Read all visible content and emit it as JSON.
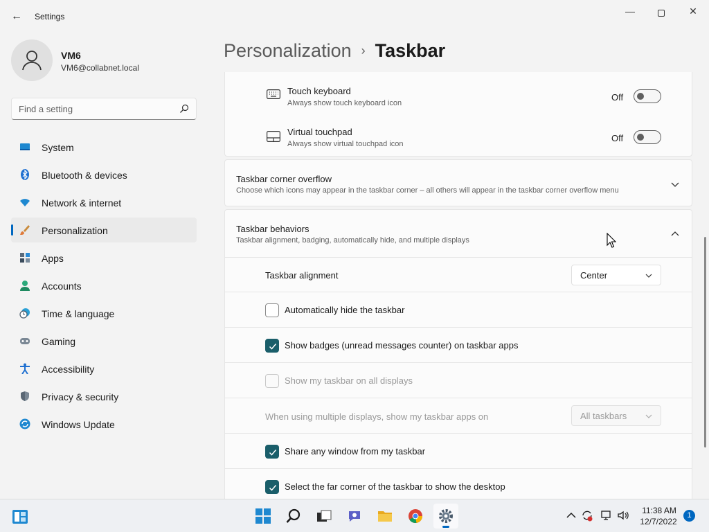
{
  "window": {
    "title": "Settings",
    "back_glyph": "←",
    "minimize_glyph": "—",
    "close_glyph": "✕"
  },
  "profile": {
    "name": "VM6",
    "email": "VM6@collabnet.local"
  },
  "search": {
    "placeholder": "Find a setting"
  },
  "nav": {
    "items": [
      {
        "label": "System",
        "icon": "system-icon"
      },
      {
        "label": "Bluetooth & devices",
        "icon": "bluetooth-icon"
      },
      {
        "label": "Network & internet",
        "icon": "wifi-icon"
      },
      {
        "label": "Personalization",
        "icon": "brush-icon",
        "active": true
      },
      {
        "label": "Apps",
        "icon": "apps-icon"
      },
      {
        "label": "Accounts",
        "icon": "accounts-icon"
      },
      {
        "label": "Time & language",
        "icon": "clock-globe-icon"
      },
      {
        "label": "Gaming",
        "icon": "gamepad-icon"
      },
      {
        "label": "Accessibility",
        "icon": "accessibility-icon"
      },
      {
        "label": "Privacy & security",
        "icon": "shield-icon"
      },
      {
        "label": "Windows Update",
        "icon": "update-icon"
      }
    ]
  },
  "breadcrumb": {
    "parent": "Personalization",
    "separator": "›",
    "current": "Taskbar"
  },
  "pen_menu": {
    "touch_keyboard": {
      "title": "Touch keyboard",
      "subtitle": "Always show touch keyboard icon",
      "state": "Off"
    },
    "virtual_touchpad": {
      "title": "Virtual touchpad",
      "subtitle": "Always show virtual touchpad icon",
      "state": "Off"
    }
  },
  "corner_overflow": {
    "title": "Taskbar corner overflow",
    "subtitle": "Choose which icons may appear in the taskbar corner – all others will appear in the taskbar corner overflow menu"
  },
  "behaviors": {
    "title": "Taskbar behaviors",
    "subtitle": "Taskbar alignment, badging, automatically hide, and multiple displays",
    "alignment_label": "Taskbar alignment",
    "alignment_value": "Center",
    "auto_hide": {
      "label": "Automatically hide the taskbar",
      "checked": false
    },
    "badges": {
      "label": "Show badges (unread messages counter) on taskbar apps",
      "checked": true
    },
    "all_displays": {
      "label": "Show my taskbar on all displays",
      "checked": false,
      "disabled": true
    },
    "multi_display_label": "When using multiple displays, show my taskbar apps on",
    "multi_display_value": "All taskbars",
    "share_window": {
      "label": "Share any window from my taskbar",
      "checked": true
    },
    "far_corner": {
      "label": "Select the far corner of the taskbar to show the desktop",
      "checked": true
    }
  },
  "taskbar": {
    "apps": [
      "start-icon",
      "search-icon",
      "task-view-icon",
      "teams-chat-icon",
      "file-explorer-icon",
      "chrome-icon",
      "settings-icon"
    ],
    "active_app": "settings-icon",
    "time": "11:38 AM",
    "date": "12/7/2022",
    "notification_count": "1"
  },
  "colors": {
    "accent": "#0067c0",
    "checkbox_checked": "#1a5e6a"
  }
}
